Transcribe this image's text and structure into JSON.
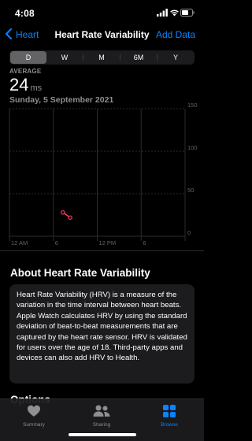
{
  "status_bar": {
    "time": "4:08"
  },
  "nav": {
    "back_label": "Heart",
    "title": "Heart Rate Variability",
    "add_label": "Add Data"
  },
  "segments": {
    "items": [
      "D",
      "W",
      "M",
      "6M",
      "Y"
    ],
    "selected": "D"
  },
  "summary": {
    "label": "AVERAGE",
    "value": "24",
    "unit": "ms",
    "date": "Sunday, 5 September 2021"
  },
  "chart_data": {
    "type": "line",
    "x_tick_labels": [
      "12 AM",
      "6",
      "12 PM",
      "6"
    ],
    "y_tick_labels": [
      "150",
      "100",
      "50",
      "0"
    ],
    "ylim": [
      0,
      150
    ],
    "xlim_hours": [
      0,
      24
    ],
    "grid": true,
    "series": [
      {
        "points": [
          {
            "hour": 7.3,
            "value": 28
          },
          {
            "hour": 8.3,
            "value": 22
          }
        ]
      }
    ],
    "colors": {
      "series": "#ff375f",
      "grid": "#2c2c2e",
      "axis_text": "#636366"
    }
  },
  "about": {
    "title": "About Heart Rate Variability",
    "body": "Heart Rate Variability (HRV) is a measure of the variation in the time interval between heart beats. Apple Watch calculates HRV by using the standard deviation of beat-to-beat measurements that are captured by the heart rate sensor. HRV is validated for users over the age of 18. Third-party apps and devices can also add HRV to Health."
  },
  "next_section_peek": "Options",
  "tab_bar": {
    "tabs": [
      {
        "label": "Summary",
        "icon": "heart-icon"
      },
      {
        "label": "Sharing",
        "icon": "people-icon"
      },
      {
        "label": "Browse",
        "icon": "grid-icon"
      }
    ],
    "selected": "Browse"
  },
  "colors": {
    "accent": "#0a84ff",
    "background": "#000000",
    "card": "#1c1c1e",
    "secondary_text": "#8e8e93"
  }
}
